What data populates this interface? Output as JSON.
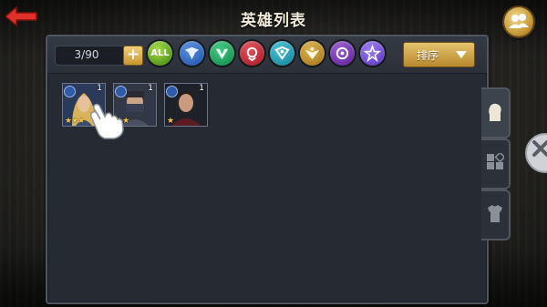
{
  "header": {
    "title": "英雄列表"
  },
  "toolbar": {
    "hero_count": "3/90",
    "add_label": "+",
    "all_filter_label": "ALL",
    "sort_label": "排序"
  },
  "factions": [
    {
      "name": "faction-blue-icon",
      "color": "#2d63b8"
    },
    {
      "name": "faction-green-icon",
      "color": "#1c9a55"
    },
    {
      "name": "faction-red-icon",
      "color": "#b42630"
    },
    {
      "name": "faction-teal-icon",
      "color": "#1f93a6"
    },
    {
      "name": "faction-gold-icon",
      "color": "#b08425"
    },
    {
      "name": "faction-purple-icon",
      "color": "#6b2fa5"
    },
    {
      "name": "faction-violet-icon",
      "color": "#6a45c8"
    }
  ],
  "heroes": [
    {
      "level": "1",
      "stars": "★★★"
    },
    {
      "level": "1",
      "stars": "★★"
    },
    {
      "level": "1",
      "stars": "★"
    }
  ],
  "side_tabs": [
    "hero-portrait-icon",
    "equipment-grid-icon",
    "armor-icon"
  ]
}
